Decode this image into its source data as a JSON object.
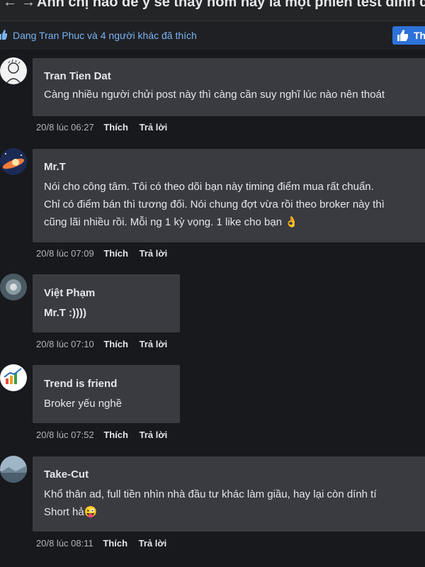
{
  "header": {
    "title": "Anh chị nào để ý sẽ thấy hôm nay là một phiên test đỉnh cũ..."
  },
  "likes": {
    "summary": "Dang Tran Phuc và 4 người khác đã thích",
    "button_label": "Th"
  },
  "comments": [
    {
      "author": "Tran Tien Dat",
      "lines": [
        "Càng nhiều người chửi post này thì càng cần suy nghĩ lúc nào nên thoát"
      ],
      "time": "20/8 lúc 06:27",
      "like_label": "Thích",
      "reply_label": "Trả lời"
    },
    {
      "author": "Mr.T",
      "lines": [
        "Nói cho công tâm. Tôi có theo dõi bạn này timing điểm mua rất chuẩn.",
        "Chỉ có điểm bán thì tương đối. Nói chung đợt vừa rồi theo broker này thì",
        "cũng lãi nhiều rồi. Mỗi ng 1 kỳ vọng. 1 like cho bạn 👌"
      ],
      "time": "20/8 lúc 07:09",
      "like_label": "Thích",
      "reply_label": "Trả lời"
    },
    {
      "author": "Việt Phạm",
      "lines": [
        "Mr.T :))))"
      ],
      "time": "20/8 lúc 07:10",
      "like_label": "Thích",
      "reply_label": "Trả lời"
    },
    {
      "author": "Trend is friend",
      "lines": [
        "Broker yếu nghề"
      ],
      "time": "20/8 lúc 07:52",
      "like_label": "Thích",
      "reply_label": "Trả lời"
    },
    {
      "author": "Take-Cut",
      "lines": [
        "Khổ thân ad, full tiền nhìn nhà đầu tư khác làm giầu, hay lại còn dính tí",
        "Short hả😜"
      ],
      "time": "20/8 lúc 08:11",
      "like_label": "Thích",
      "reply_label": "Trả lời"
    }
  ],
  "colors": {
    "background": "#18191d",
    "bubble": "#3a3b40",
    "like_button": "#2d72d9",
    "link": "#7ab3f0"
  }
}
